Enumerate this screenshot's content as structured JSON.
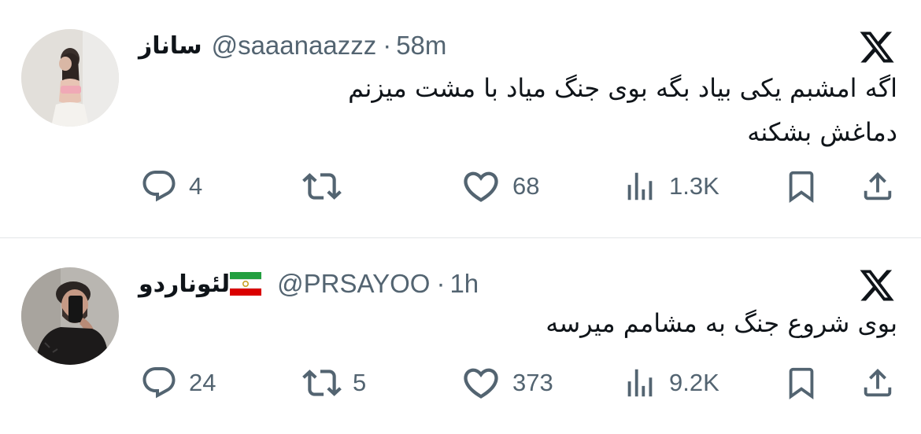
{
  "tweets": [
    {
      "display_name": "ساناز",
      "handle": "@saaanaazzz",
      "separator": "·",
      "time": "58m",
      "text_line1": "اگه امشبم یکی بیاد بگه بوی جنگ میاد با مشت میزنم",
      "text_line2": "دماغش بشکنه",
      "replies": "4",
      "retweets": "",
      "likes": "68",
      "views": "1.3K"
    },
    {
      "display_name": "لئوناردو",
      "handle": "@PRSAYOO",
      "separator": "·",
      "time": "1h",
      "text_line1": "بوی شروع جنگ به مشامم میرسه",
      "replies": "24",
      "retweets": "5",
      "likes": "373",
      "views": "9.2K"
    }
  ],
  "icons": {
    "reply": "speech-bubble-icon",
    "retweet": "retweet-arrows-icon",
    "like": "heart-icon",
    "views": "bar-chart-icon",
    "bookmark": "bookmark-icon",
    "share": "upload-share-icon",
    "brand": "x-logo-icon"
  },
  "colors": {
    "text": "#0f1419",
    "secondary": "#536471",
    "divider": "#e3e6e8"
  }
}
